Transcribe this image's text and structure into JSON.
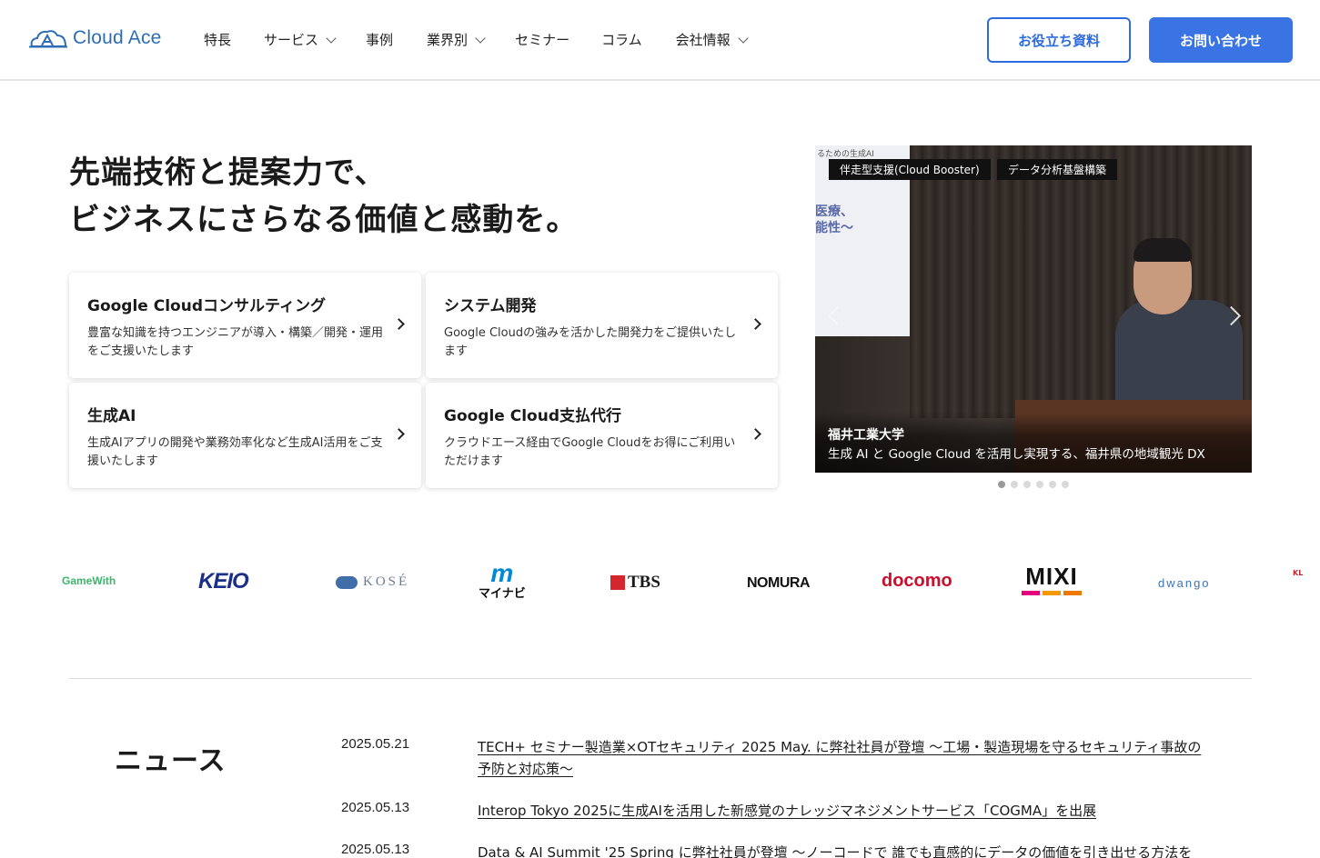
{
  "header": {
    "logo_text": "Cloud Ace",
    "nav": [
      {
        "label": "特長",
        "has_dropdown": false
      },
      {
        "label": "サービス",
        "has_dropdown": true
      },
      {
        "label": "事例",
        "has_dropdown": false
      },
      {
        "label": "業界別",
        "has_dropdown": true
      },
      {
        "label": "セミナー",
        "has_dropdown": false
      },
      {
        "label": "コラム",
        "has_dropdown": false
      },
      {
        "label": "会社情報",
        "has_dropdown": true
      }
    ],
    "resources_button": "お役立ち資料",
    "contact_button": "お問い合わせ",
    "accent_color": "#3a73e4"
  },
  "hero": {
    "title_line1": "先端技術と提案力で、",
    "title_line2": "ビジネスにさらなる価値と感動を。",
    "cards": [
      {
        "title": "Google Cloudコンサルティング",
        "desc": "豊富な知識を持つエンジニアが導入・構築／開発・運用をご支援いたします"
      },
      {
        "title": "システム開発",
        "desc": "Google Cloudの強みを活かした開発力をご提供いたします"
      },
      {
        "title": "生成AI",
        "desc": "生成AIアプリの開発や業務効率化など生成AI活用をご支援いたします"
      },
      {
        "title": "Google Cloud支払代行",
        "desc": "クラウドエース経由でGoogle Cloudをお得にご利用いただけます"
      }
    ]
  },
  "carousel": {
    "tags": [
      "伴走型支援(Cloud Booster)",
      "データ分析基盤構築"
    ],
    "screen_top": "るための生成AI",
    "screen_text_1": "医療、",
    "screen_text_2": "能性〜",
    "caption_title": "福井工業大学",
    "caption_sub": "生成 AI と Google Cloud を活用し実現する、福井県の地域観光 DX",
    "slide_count": 6,
    "active_slide": 1
  },
  "clients": {
    "gamewith": "GameWith",
    "keio": "KEIO",
    "kose": "KOSÉ",
    "mynavi_mark": "m",
    "mynavi": "マイナビ",
    "tbs": "TBS",
    "nomura": "NOMURA",
    "docomo": "docomo",
    "mixi": "MIXI",
    "dwango": "dwango",
    "kl": "KL"
  },
  "news": {
    "heading": "ニュース",
    "items": [
      {
        "date": "2025.05.21",
        "title": "TECH+ セミナー製造業×OTセキュリティ 2025 May. に弊社社員が登壇 〜工場・製造現場を守るセキュリティ事故の予防と対応策〜"
      },
      {
        "date": "2025.05.13",
        "title": "Interop Tokyo 2025に生成AIを活用した新感覚のナレッジマネジメントサービス「COGMA」を出展"
      },
      {
        "date": "2025.05.13",
        "title": "Data & AI Summit '25 Spring に弊社社員が登壇 〜ノーコードで 誰でも直感的にデータの価値を引き出せる方法を"
      }
    ]
  }
}
